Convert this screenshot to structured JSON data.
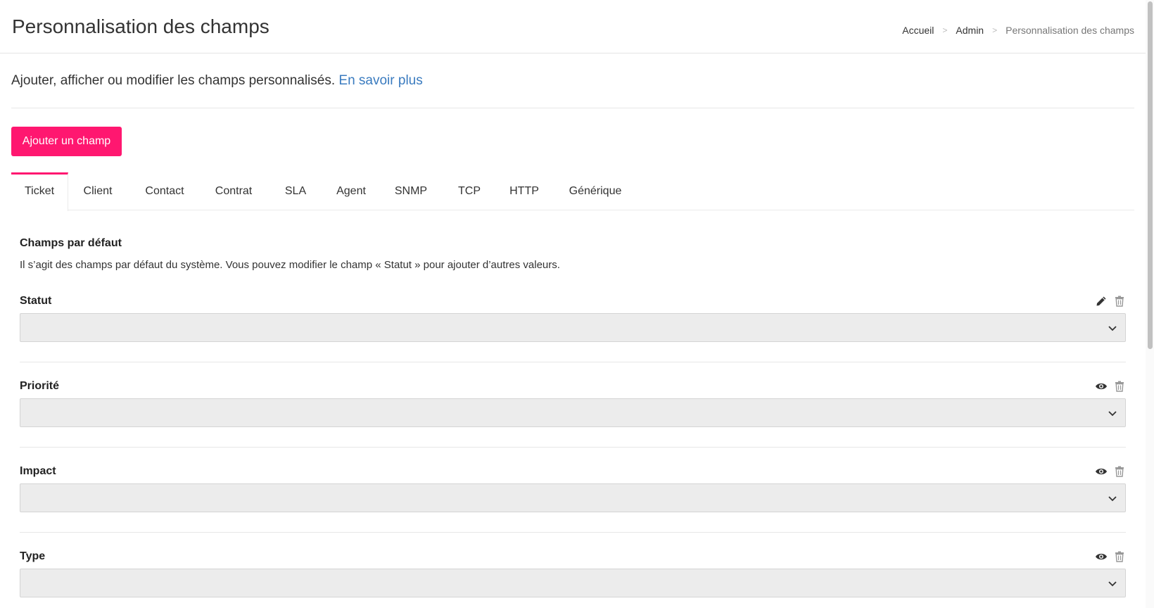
{
  "header": {
    "title": "Personnalisation des champs",
    "breadcrumb": [
      "Accueil",
      "Admin",
      "Personnalisation des champs"
    ],
    "separator": ">"
  },
  "intro": {
    "text": "Ajouter, afficher ou modifier les champs personnalisés.",
    "link": "En savoir plus"
  },
  "add_button": "Ajouter un champ",
  "tabs": [
    "Ticket",
    "Client",
    "Contact",
    "Contrat",
    "SLA",
    "Agent",
    "SNMP",
    "TCP",
    "HTTP",
    "Générique"
  ],
  "active_tab": "Ticket",
  "section": {
    "title": "Champs par défaut",
    "description": "Il s’agit des champs par défaut du système. Vous pouvez modifier le champ « Statut » pour ajouter d’autres valeurs."
  },
  "fields": [
    {
      "label": "Statut",
      "value": "",
      "icons": [
        "pencil-icon",
        "trash-icon"
      ]
    },
    {
      "label": "Priorité",
      "value": "",
      "icons": [
        "eye-icon",
        "trash-icon"
      ]
    },
    {
      "label": "Impact",
      "value": "",
      "icons": [
        "eye-icon",
        "trash-icon"
      ]
    },
    {
      "label": "Type",
      "value": "",
      "icons": [
        "eye-icon",
        "trash-icon"
      ]
    }
  ],
  "colors": {
    "accent": "#ff1770",
    "link": "#3a7bbf",
    "select_bg": "#ececec"
  }
}
